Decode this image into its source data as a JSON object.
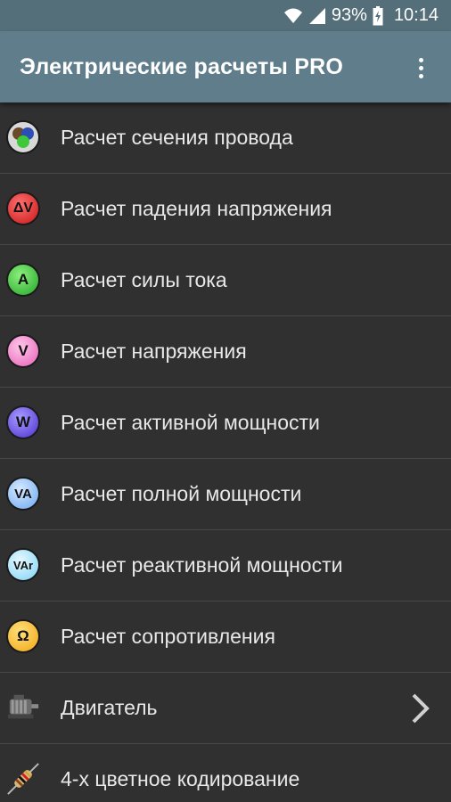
{
  "status_bar": {
    "battery_percent": "93%",
    "time": "10:14",
    "icons": [
      "wifi-icon",
      "signal-icon",
      "battery-icon"
    ]
  },
  "app_bar": {
    "title": "Электрические расчеты PRO",
    "menu_icon": "more-vert-icon"
  },
  "list": {
    "items": [
      {
        "label": "Расчет сечения провода",
        "icon": "wire-section-icon"
      },
      {
        "label": "Расчет падения напряжения",
        "icon": "voltage-drop-icon",
        "icon_text": "ΔV"
      },
      {
        "label": "Расчет силы тока",
        "icon": "current-icon",
        "icon_text": "A"
      },
      {
        "label": "Расчет напряжения",
        "icon": "voltage-icon",
        "icon_text": "V"
      },
      {
        "label": "Расчет активной мощности",
        "icon": "active-power-icon",
        "icon_text": "W"
      },
      {
        "label": "Расчет полной мощности",
        "icon": "apparent-power-icon",
        "icon_text": "VA"
      },
      {
        "label": "Расчет реактивной мощности",
        "icon": "reactive-power-icon",
        "icon_text": "VAr"
      },
      {
        "label": "Расчет сопротивления",
        "icon": "resistance-icon",
        "icon_text": "Ω"
      },
      {
        "label": "Двигатель",
        "icon": "motor-icon",
        "has_submenu": true
      },
      {
        "label": "4-х цветное кодирование",
        "icon": "resistor-color-code-icon"
      }
    ]
  },
  "colors": {
    "status_bar": "#546f7a",
    "app_bar": "#607d8b",
    "background": "#303030",
    "divider": "#474747",
    "text": "#e8e8e8"
  }
}
